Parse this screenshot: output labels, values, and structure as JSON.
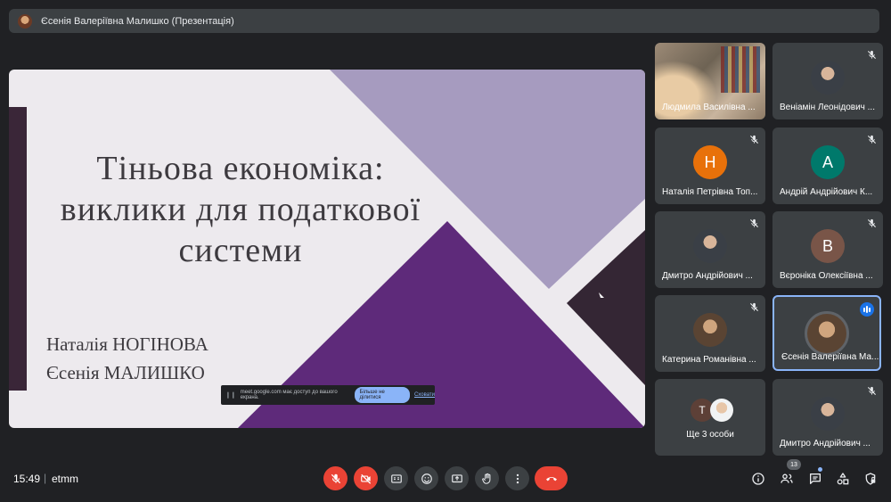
{
  "presenter": {
    "name": "Єсенія Валеріївна Малишко (Презентація)"
  },
  "slide": {
    "title_lines": [
      "Тіньова економіка:",
      "виклики для податкової",
      "системи"
    ],
    "authors": [
      "Наталія НОГІНОВА",
      "Єсенія МАЛИШКО"
    ]
  },
  "share_notice": {
    "text": "meet.google.com має доступ до вашого екрана.",
    "stop_label": "Більше не ділитися",
    "hide_label": "Сховати"
  },
  "participants": [
    {
      "name": "Людмила Василівна ...",
      "type": "video",
      "muted": false
    },
    {
      "name": "Веніамін Леонідович ...",
      "type": "photo",
      "muted": true
    },
    {
      "name": "Наталія Петрівна Топ...",
      "type": "initial",
      "initial": "Н",
      "color": "#e8710a",
      "muted": true
    },
    {
      "name": "Андрій Андрійович К...",
      "type": "initial",
      "initial": "А",
      "color": "#00796b",
      "muted": true
    },
    {
      "name": "Дмитро Андрійович ...",
      "type": "photo",
      "muted": true
    },
    {
      "name": "Вєроніка Олексіївна ...",
      "type": "initial",
      "initial": "В",
      "color": "#795548",
      "muted": true
    },
    {
      "name": "Катерина Романівна ...",
      "type": "photo",
      "muted": true
    },
    {
      "name": "Єсенія Валеріївна Ма...",
      "type": "photo",
      "muted": false,
      "speaking": true
    },
    {
      "name": "Дмитро Андрійович ...",
      "type": "photo",
      "muted": true
    }
  ],
  "more": {
    "label": "Ще 3 особи",
    "initial": "Т",
    "initial_color": "#5d4037"
  },
  "bottom": {
    "time": "15:49",
    "separator": "|",
    "meeting_code": "etmm",
    "people_count": "13"
  },
  "colors": {
    "background": "#202124",
    "tile": "#3c4043",
    "danger": "#ea4335",
    "accent": "#8ab4f8"
  }
}
